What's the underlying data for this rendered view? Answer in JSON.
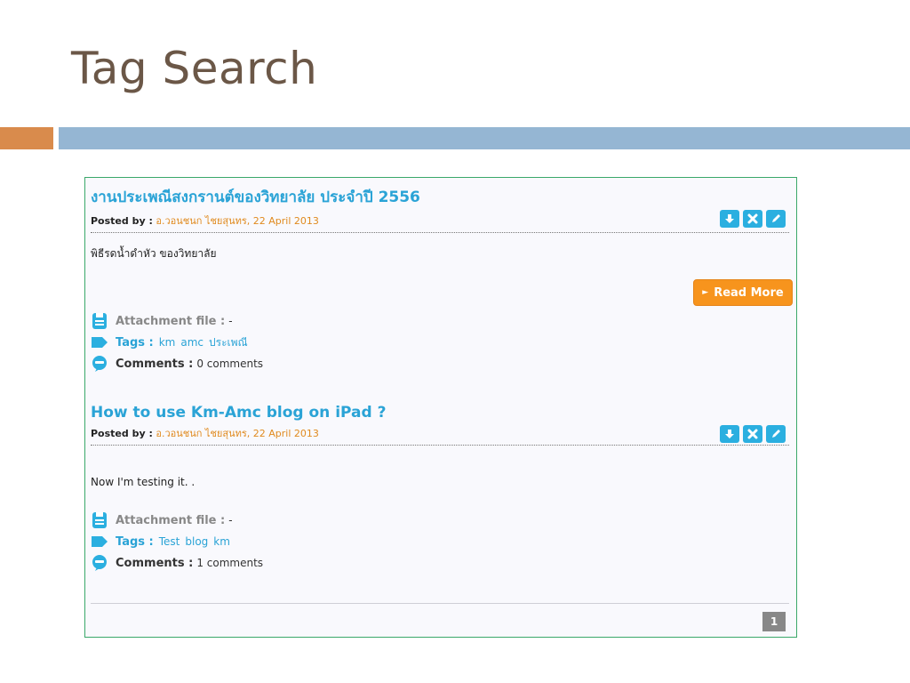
{
  "slide": {
    "title": "Tag Search"
  },
  "posts": [
    {
      "title": "งานประเพณีสงกรานต์ของวิทยาลัย ประจำปี 2556",
      "posted_label": "Posted by :",
      "posted_meta": "อ.วอนชนก ไชยสุนทร, 22 April 2013",
      "body": "พิธีรดน้ำดำหัว ของวิทยาลัย",
      "read_more": "Read More",
      "attachment_label": "Attachment file :",
      "attachment_value": "-",
      "tags_label": "Tags :",
      "tags": [
        "km",
        "amc",
        "ประเพณี"
      ],
      "comments_label": "Comments :",
      "comments_value": "0 comments"
    },
    {
      "title": "How to use Km-Amc blog on iPad ?",
      "posted_label": "Posted by :",
      "posted_meta": "อ.วอนชนก ไชยสุนทร, 22 April 2013",
      "body": "Now I'm testing it. .",
      "attachment_label": "Attachment file :",
      "attachment_value": "-",
      "tags_label": "Tags :",
      "tags": [
        "Test",
        "blog",
        "km"
      ],
      "comments_label": "Comments :",
      "comments_value": "1 comments"
    }
  ],
  "pagination": {
    "current": "1"
  },
  "colors": {
    "title_text": "#6b5747",
    "accent_orange": "#d98b4c",
    "accent_blue": "#95b6d3",
    "link_blue": "#2aa3d6",
    "button_orange": "#f7941d",
    "panel_border": "#3aa86a"
  },
  "icons": {
    "action_buttons": [
      "download-icon",
      "delete-icon",
      "edit-icon"
    ],
    "attachment": "document-icon",
    "tags": "tag-icon",
    "comments": "comment-bubble-icon"
  }
}
